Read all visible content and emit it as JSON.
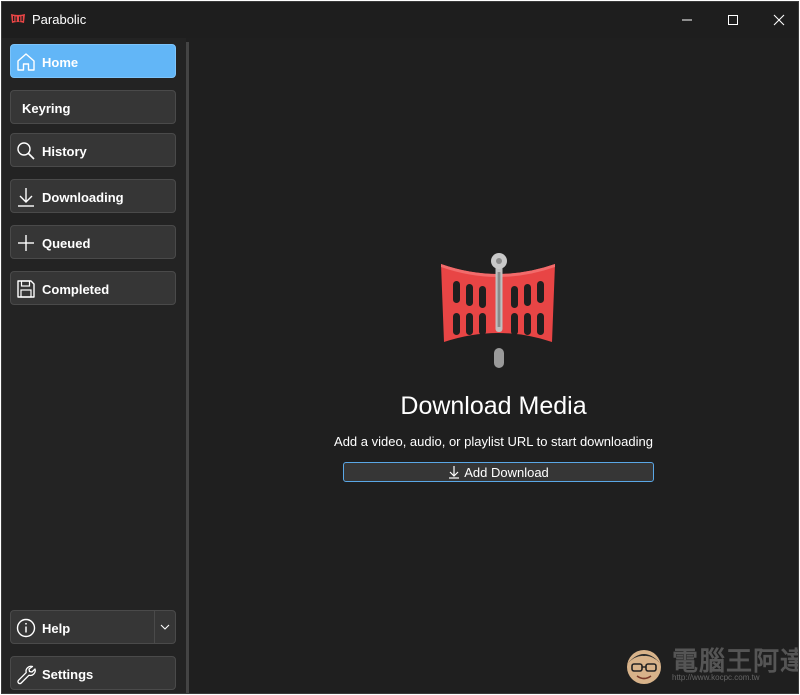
{
  "window": {
    "title": "Parabolic",
    "controls": {
      "minimize": "minimize-icon",
      "maximize": "maximize-icon",
      "close": "close-icon"
    }
  },
  "sidebar": {
    "items": [
      {
        "label": "Home",
        "icon": "home-icon",
        "active": true
      },
      {
        "label": "Keyring",
        "icon": "",
        "active": false
      },
      {
        "label": "History",
        "icon": "search-icon",
        "active": false
      },
      {
        "label": "Downloading",
        "icon": "download-arrow-icon",
        "active": false
      },
      {
        "label": "Queued",
        "icon": "plus-icon",
        "active": false
      },
      {
        "label": "Completed",
        "icon": "floppy-disk-icon",
        "active": false
      }
    ],
    "bottom_items": [
      {
        "label": "Help",
        "icon": "info-icon"
      },
      {
        "label": "Settings",
        "icon": "wrench-icon"
      }
    ]
  },
  "main": {
    "title": "Download Media",
    "subtitle": "Add a video, audio, or playlist URL to start downloading",
    "add_button_label": "Add Download"
  },
  "watermark": {
    "text": "電腦王阿達",
    "url": "http://www.kocpc.com.tw"
  },
  "colors": {
    "accent": "#62b6f7",
    "background": "#1f1f1f",
    "button": "#363636",
    "logo_red": "#e84545"
  }
}
